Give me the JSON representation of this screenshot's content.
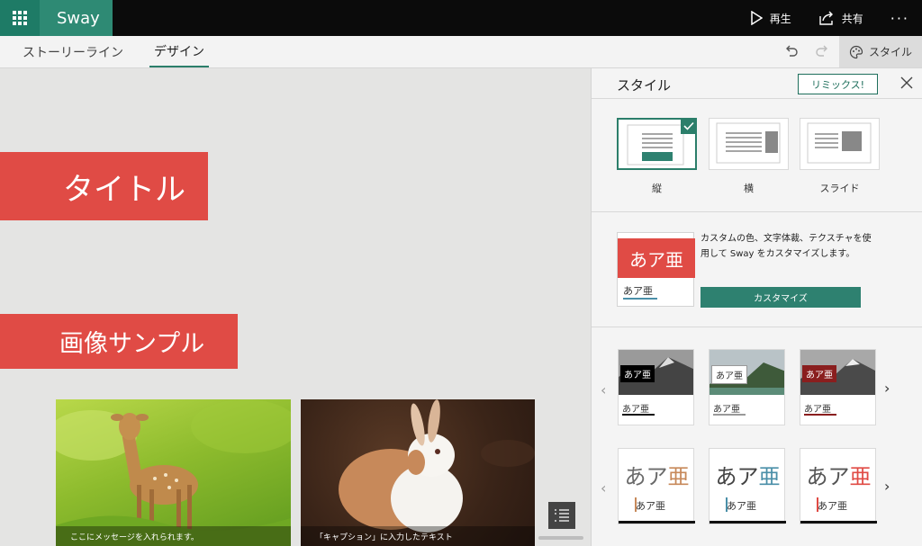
{
  "app": {
    "name": "Sway"
  },
  "topbar": {
    "play_label": "再生",
    "share_label": "共有",
    "more_label": "···"
  },
  "tabs": [
    {
      "label": "ストーリーライン"
    },
    {
      "label": "デザイン"
    }
  ],
  "style_button": {
    "label": "スタイル"
  },
  "canvas": {
    "title": "タイトル",
    "section_heading": "画像サンプル",
    "captions": [
      "ここにメッセージを入れられます。",
      "「キャプション」に入力したテキスト"
    ]
  },
  "panel": {
    "title": "スタイル",
    "remix_label": "リミックス!",
    "layouts": [
      {
        "label": "縦"
      },
      {
        "label": "横"
      },
      {
        "label": "スライド"
      }
    ],
    "custom": {
      "sample_large": "あア亜",
      "sample_small": "あア亜",
      "description": "カスタムの色、文字体裁、テクスチャを使用して Sway をカスタマイズします。",
      "button_label": "カスタマイズ"
    },
    "theme_sample_text": "あア亜",
    "font_sample_text": "あア亜"
  },
  "colors": {
    "accent": "#2b7e6a",
    "brand_red": "#e04b45"
  }
}
